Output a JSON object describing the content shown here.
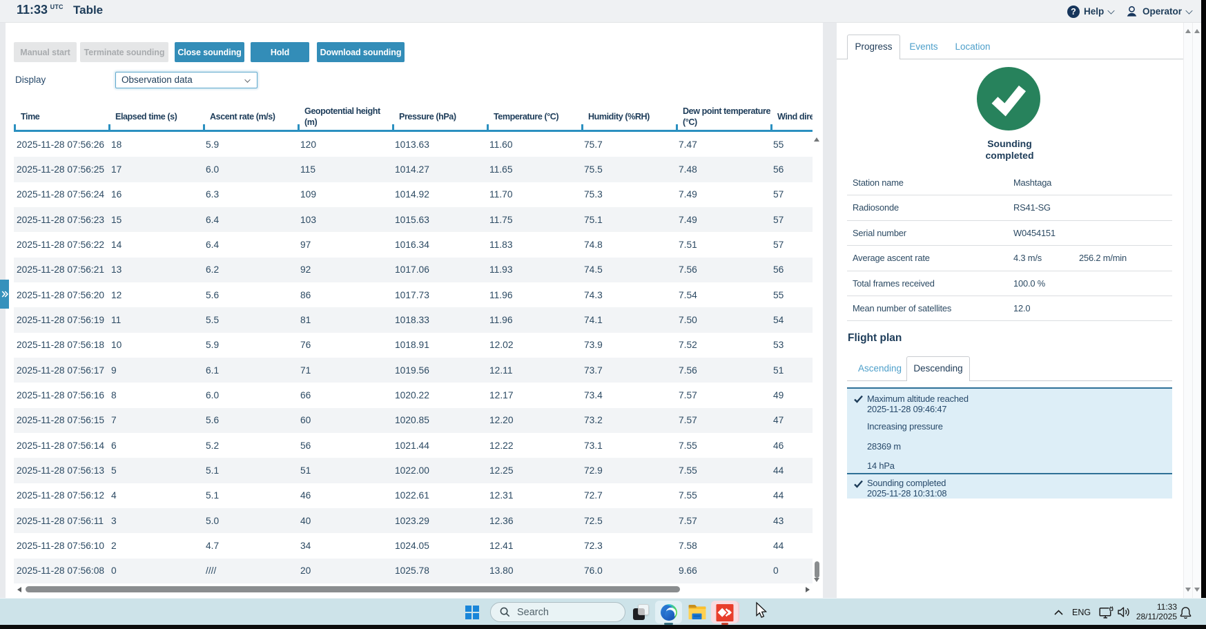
{
  "colors": {
    "accent_blue": "#338db8",
    "header_underline": "#2b90c0",
    "navy": "#1d3c59",
    "success_green": "#27825c",
    "flight_panel_blue": "#ddeef7",
    "taskbar": "#cde3e9"
  },
  "header": {
    "time": "11:33",
    "time_zone": "UTC",
    "title": "Table",
    "help_label": "Help",
    "operator_label": "Operator"
  },
  "toolbar": {
    "buttons": [
      {
        "label": "Manual start",
        "enabled": false
      },
      {
        "label": "Terminate sounding",
        "enabled": false
      },
      {
        "label": "Close sounding",
        "enabled": true
      },
      {
        "label": "Hold",
        "enabled": true
      },
      {
        "label": "Download sounding",
        "enabled": true
      }
    ],
    "display_label": "Display",
    "display_value": "Observation data"
  },
  "table": {
    "columns": [
      {
        "lines": [
          "Time"
        ]
      },
      {
        "lines": [
          "Elapsed time (s)"
        ]
      },
      {
        "lines": [
          "Ascent rate (m/s)"
        ]
      },
      {
        "lines": [
          "Geopotential height",
          "(m)"
        ]
      },
      {
        "lines": [
          "Pressure (hPa)"
        ]
      },
      {
        "lines": [
          "Temperature (°C)"
        ]
      },
      {
        "lines": [
          "Humidity (%RH)"
        ]
      },
      {
        "lines": [
          "Dew point temperature",
          "(°C)"
        ]
      },
      {
        "lines": [
          "Wind dire"
        ]
      }
    ],
    "rows": [
      [
        "2025-11-28 07:56:26",
        "18",
        "5.9",
        "120",
        "1013.63",
        "11.60",
        "75.7",
        "7.47",
        "55"
      ],
      [
        "2025-11-28 07:56:25",
        "17",
        "6.0",
        "115",
        "1014.27",
        "11.65",
        "75.5",
        "7.48",
        "56"
      ],
      [
        "2025-11-28 07:56:24",
        "16",
        "6.3",
        "109",
        "1014.92",
        "11.70",
        "75.3",
        "7.49",
        "57"
      ],
      [
        "2025-11-28 07:56:23",
        "15",
        "6.4",
        "103",
        "1015.63",
        "11.75",
        "75.1",
        "7.49",
        "57"
      ],
      [
        "2025-11-28 07:56:22",
        "14",
        "6.4",
        "97",
        "1016.34",
        "11.83",
        "74.8",
        "7.51",
        "57"
      ],
      [
        "2025-11-28 07:56:21",
        "13",
        "6.2",
        "92",
        "1017.06",
        "11.93",
        "74.5",
        "7.56",
        "56"
      ],
      [
        "2025-11-28 07:56:20",
        "12",
        "5.6",
        "86",
        "1017.73",
        "11.96",
        "74.3",
        "7.54",
        "55"
      ],
      [
        "2025-11-28 07:56:19",
        "11",
        "5.5",
        "81",
        "1018.33",
        "11.96",
        "74.1",
        "7.50",
        "54"
      ],
      [
        "2025-11-28 07:56:18",
        "10",
        "5.9",
        "76",
        "1018.91",
        "12.02",
        "73.9",
        "7.52",
        "53"
      ],
      [
        "2025-11-28 07:56:17",
        "9",
        "6.1",
        "71",
        "1019.56",
        "12.11",
        "73.7",
        "7.56",
        "51"
      ],
      [
        "2025-11-28 07:56:16",
        "8",
        "6.0",
        "66",
        "1020.22",
        "12.17",
        "73.4",
        "7.57",
        "49"
      ],
      [
        "2025-11-28 07:56:15",
        "7",
        "5.6",
        "60",
        "1020.85",
        "12.20",
        "73.2",
        "7.57",
        "47"
      ],
      [
        "2025-11-28 07:56:14",
        "6",
        "5.2",
        "56",
        "1021.44",
        "12.22",
        "73.1",
        "7.55",
        "46"
      ],
      [
        "2025-11-28 07:56:13",
        "5",
        "5.1",
        "51",
        "1022.00",
        "12.25",
        "72.9",
        "7.55",
        "44"
      ],
      [
        "2025-11-28 07:56:12",
        "4",
        "5.1",
        "46",
        "1022.61",
        "12.31",
        "72.7",
        "7.55",
        "44"
      ],
      [
        "2025-11-28 07:56:11",
        "3",
        "5.0",
        "40",
        "1023.29",
        "12.36",
        "72.5",
        "7.57",
        "43"
      ],
      [
        "2025-11-28 07:56:10",
        "2",
        "4.7",
        "34",
        "1024.05",
        "12.41",
        "72.3",
        "7.58",
        "44"
      ],
      [
        "2025-11-28 07:56:08",
        "0",
        "////",
        "20",
        "1025.78",
        "13.80",
        "76.0",
        "9.66",
        "0"
      ]
    ]
  },
  "side_panel": {
    "tabs": {
      "progress": "Progress",
      "events": "Events",
      "location": "Location"
    },
    "active_tab": "Progress",
    "status_line1": "Sounding",
    "status_line2": "completed",
    "info": [
      {
        "label": "Station name",
        "value": "Mashtaga",
        "value2": ""
      },
      {
        "label": "Radiosonde",
        "value": "RS41-SG",
        "value2": ""
      },
      {
        "label": "Serial number",
        "value": "W0454151",
        "value2": ""
      },
      {
        "label": "Average ascent rate",
        "value": "4.3 m/s",
        "value2": "256.2 m/min"
      },
      {
        "label": "Total frames received",
        "value": "100.0 %",
        "value2": ""
      },
      {
        "label": "Mean number of satellites",
        "value": "12.0",
        "value2": ""
      }
    ],
    "flight_plan": {
      "heading": "Flight plan",
      "tab_ascending": "Ascending",
      "tab_descending": "Descending",
      "active_tab": "Descending",
      "block1": {
        "item1_title": "Maximum altitude reached",
        "item1_time": "2025-11-28 09:46:47",
        "item2": "Increasing pressure",
        "item3": "28369 m",
        "item4": "14 hPa"
      },
      "block2": {
        "item1_title": "Sounding completed",
        "item1_time": "2025-11-28 10:31:08"
      }
    }
  },
  "taskbar": {
    "search_placeholder": "Search",
    "language": "ENG",
    "clock_time": "11:33",
    "clock_date": "28/11/2025"
  }
}
